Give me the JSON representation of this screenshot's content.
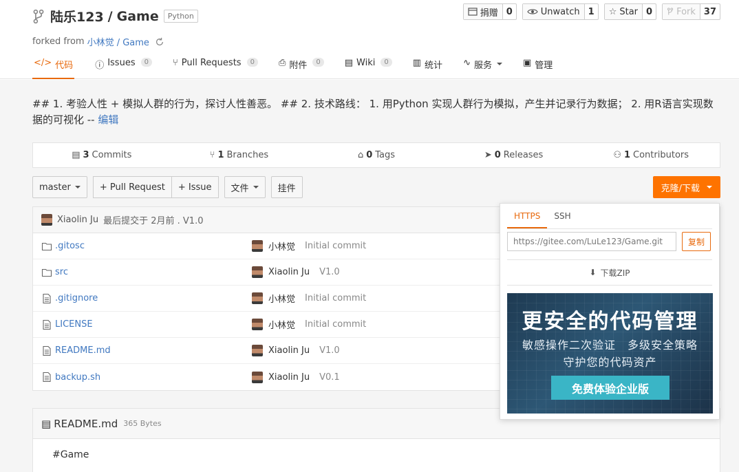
{
  "repo": {
    "owner": "陆乐123",
    "separator": "/",
    "name": "Game",
    "language": "Python",
    "forked_prefix": "forked from",
    "forked_source": "小林觉 / Game"
  },
  "actions": [
    {
      "label": "捐赠",
      "count": "0"
    },
    {
      "label": "Unwatch",
      "count": "1"
    },
    {
      "label": "Star",
      "count": "0"
    },
    {
      "label": "Fork",
      "count": "37"
    }
  ],
  "tabs": [
    {
      "label": "代码",
      "badge": null
    },
    {
      "label": "Issues",
      "badge": "0"
    },
    {
      "label": "Pull Requests",
      "badge": "0"
    },
    {
      "label": "附件",
      "badge": "0"
    },
    {
      "label": "Wiki",
      "badge": "0"
    },
    {
      "label": "统计",
      "badge": null
    },
    {
      "label": "服务",
      "badge": null
    },
    {
      "label": "管理",
      "badge": null
    }
  ],
  "description": {
    "text": "## 1. 考验人性 + 模拟人群的行为，探讨人性善恶。 ## 2. 技术路线： 1. 用Python 实现人群行为模拟，产生并记录行为数据； 2. 用R语言实现数据的可视化 -- ",
    "edit_link": "编辑"
  },
  "stats": [
    {
      "count": "3",
      "label": "Commits"
    },
    {
      "count": "1",
      "label": "Branches"
    },
    {
      "count": "0",
      "label": "Tags"
    },
    {
      "count": "0",
      "label": "Releases"
    },
    {
      "count": "1",
      "label": "Contributors"
    }
  ],
  "toolbar": {
    "branch": "master",
    "pull_request": "+ Pull Request",
    "issue": "+ Issue",
    "files": "文件",
    "mount": "挂件",
    "clone": "克隆/下载"
  },
  "latest_commit": {
    "author": "Xiaolin Ju",
    "text": "最后提交于 2月前 . V1.0"
  },
  "files": [
    {
      "name": ".gitosc",
      "type": "folder",
      "author": "小林觉",
      "message": "Initial commit"
    },
    {
      "name": "src",
      "type": "folder",
      "author": "Xiaolin Ju",
      "message": "V1.0"
    },
    {
      "name": ".gitignore",
      "type": "file",
      "author": "小林觉",
      "message": "Initial commit"
    },
    {
      "name": "LICENSE",
      "type": "file",
      "author": "小林觉",
      "message": "Initial commit"
    },
    {
      "name": "README.md",
      "type": "file",
      "author": "Xiaolin Ju",
      "message": "V1.0"
    },
    {
      "name": "backup.sh",
      "type": "file",
      "author": "Xiaolin Ju",
      "message": "V0.1"
    }
  ],
  "readme": {
    "title": "README.md",
    "size": "365 Bytes",
    "body": "#Game"
  },
  "clone_popup": {
    "tabs": [
      "HTTPS",
      "SSH"
    ],
    "url": "https://gitee.com/LuLe123/Game.git",
    "copy": "复制",
    "zip": "下载ZIP",
    "banner_title": "更安全的代码管理",
    "banner_line1": "敏感操作二次验证　多级安全策略",
    "banner_line2": "守护您的代码资产",
    "banner_button": "免费体验企业版"
  },
  "colors": {
    "accent": "#e8690c",
    "clone_button": "#fe7300",
    "link": "#4078c0",
    "banner_button": "#3ab5c6"
  }
}
